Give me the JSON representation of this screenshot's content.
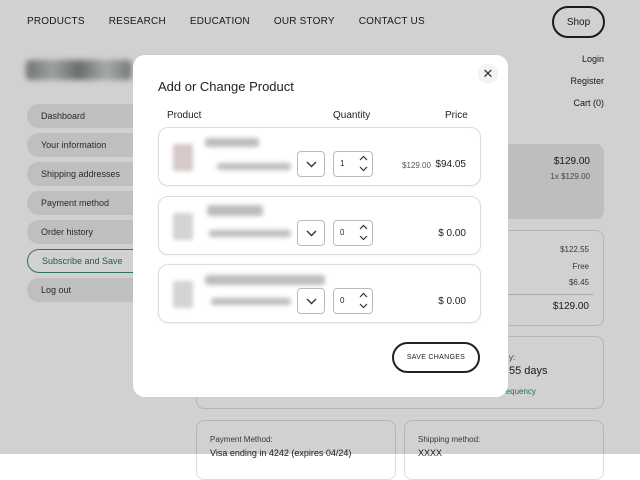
{
  "nav": {
    "items": [
      "PRODUCTS",
      "RESEARCH",
      "EDUCATION",
      "OUR STORY",
      "CONTACT US"
    ],
    "shop_label": "Shop"
  },
  "account_links": {
    "login": "Login",
    "register": "Register",
    "cart": "Cart (0)"
  },
  "sidebar": {
    "items": [
      "Dashboard",
      "Your information",
      "Shipping addresses",
      "Payment method",
      "Order history",
      "Subscribe and Save",
      "Log out"
    ],
    "active_index": 5
  },
  "summary": {
    "total": "$129.00",
    "breakdown": "1x $129.00"
  },
  "totals": {
    "subtotal": "$122.55",
    "shipping": "Free",
    "tax": "$6.45",
    "total": "$129.00"
  },
  "frequency": {
    "label_tail": "y:",
    "value_tail": "55 days",
    "link_tail": "requency"
  },
  "payment": {
    "label": "Payment Method:",
    "value": "Visa ending in 4242 (expires 04/24)"
  },
  "shipping": {
    "label": "Shipping method:",
    "value": "XXXX"
  },
  "modal": {
    "title": "Add or Change Product",
    "headers": {
      "product": "Product",
      "quantity": "Quantity",
      "price": "Price"
    },
    "rows": [
      {
        "quantity": "1",
        "old_price": "$129.00",
        "price": "$94.05"
      },
      {
        "quantity": "0",
        "old_price": "",
        "price": "$ 0.00"
      },
      {
        "quantity": "0",
        "old_price": "",
        "price": "$ 0.00"
      }
    ],
    "save_label": "SAVE CHANGES",
    "close_symbol": "✕"
  },
  "colors": {
    "accent": "#3b8a76",
    "link": "#2e8a6f",
    "overlay": "rgba(0,0,0,0.18)"
  }
}
